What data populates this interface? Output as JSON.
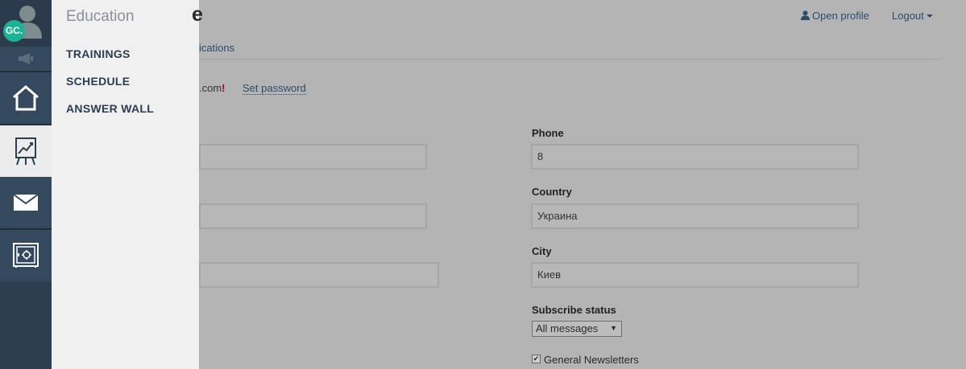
{
  "user": {
    "initials": "GC."
  },
  "flyout": {
    "heading": "Education",
    "links": [
      "TRAININGS",
      "SCHEDULE",
      "ANSWER WALL"
    ]
  },
  "header": {
    "title_fragment": "e",
    "open_profile": "Open profile",
    "logout": "Logout"
  },
  "tabs": {
    "fragment": "ications"
  },
  "account": {
    "email_fragment": ".com",
    "email_warning": "!",
    "set_password": "Set password"
  },
  "form": {
    "phone": {
      "label": "Phone",
      "value": "8"
    },
    "country": {
      "label": "Country",
      "value": "Украина"
    },
    "city": {
      "label": "City",
      "value": "Киев"
    },
    "subscribe": {
      "label": "Subscribe status",
      "selected": "All messages"
    },
    "newsletter": {
      "label": "General Newsletters",
      "checked": true,
      "mark": "✔"
    }
  },
  "rail_icons": [
    "user-avatar",
    "megaphone-icon",
    "home-icon",
    "chart-easel-icon",
    "mail-icon",
    "safe-icon"
  ]
}
